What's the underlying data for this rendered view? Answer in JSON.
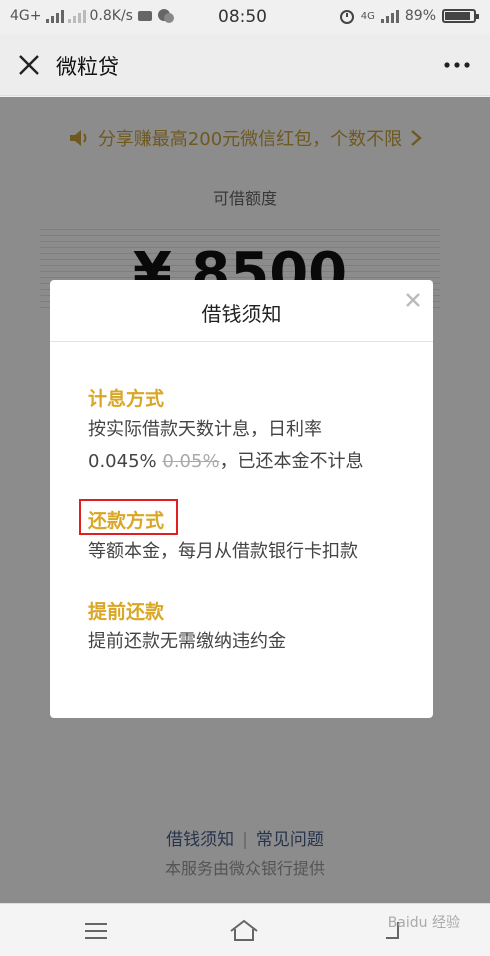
{
  "status_bar": {
    "network": "4G+",
    "speed": "0.8K/s",
    "time": "08:50",
    "network_right": "4G",
    "battery": "89%",
    "battery_level": 0.89
  },
  "navbar": {
    "title": "微粒贷"
  },
  "page": {
    "promo": "分享赚最高200元微信红包，个数不限",
    "limit_label": "可借额度",
    "amount": "¥ 8500",
    "footer_link_1": "借钱须知",
    "footer_link_2": "常见问题",
    "footer_note": "本服务由微众银行提供"
  },
  "modal": {
    "title": "借钱须知",
    "sections": [
      {
        "title": "计息方式",
        "line1": "按实际借款天数计息，日利率",
        "line2_rate": "0.045%",
        "line2_old_rate": "0.05%",
        "line2_rest": "，已还本金不计息"
      },
      {
        "title": "还款方式",
        "line1": "等额本金，每月从借款银行卡扣款"
      },
      {
        "title": "提前还款",
        "line1": "提前还款无需缴纳违约金"
      }
    ]
  },
  "watermark": "Baidu 经验",
  "colors": {
    "accent": "#d9a726",
    "highlight": "#e02020",
    "link": "#4a5e8a"
  }
}
